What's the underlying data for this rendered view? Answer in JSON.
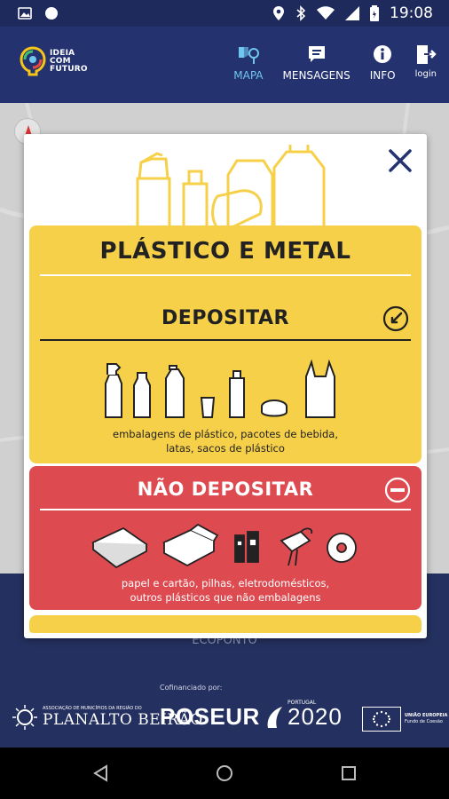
{
  "status_bar": {
    "time": "19:08"
  },
  "brand": {
    "line1": "IDEIA",
    "line2": "COM",
    "line3": "FUTURO"
  },
  "nav": [
    {
      "label": "MAPA",
      "active": true,
      "icon": "map-marker-icon"
    },
    {
      "label": "MENSAGENS",
      "active": false,
      "icon": "chat-icon"
    },
    {
      "label": "INFO",
      "active": false,
      "icon": "info-icon"
    },
    {
      "label": "login",
      "active": false,
      "icon": "login-icon"
    }
  ],
  "modal": {
    "title": "PLÁSTICO E METAL",
    "depositar": {
      "label": "DEPOSITAR",
      "caption_line1": "embalagens de plástico, pacotes de bebida,",
      "caption_line2": "latas, sacos de plástico"
    },
    "nao_depositar": {
      "label": "NÃO DEPOSITAR",
      "caption_line1": "papel e cartão, pilhas, eletrodomésticos,",
      "caption_line2": "outros plásticos que não embalagens"
    }
  },
  "background_label": "ECOPONTO",
  "sponsors": {
    "cofinanciado": "Cofinanciado por:",
    "planalto": "PLANALTO BEIRÃO",
    "planalto_sub": "ASSOCIAÇÃO DE MUNICÍPIOS DA REGIÃO DO",
    "poseur": "POSEUR",
    "portugal": "PORTUGAL",
    "portugal_year": "2020",
    "eu_line1": "UNIÃO EUROPEIA",
    "eu_line2": "Fundo de Coesão"
  },
  "colors": {
    "header": "#243270",
    "yellow": "#f7d049",
    "red": "#dd4b51",
    "active_nav": "#6fc6ef"
  }
}
